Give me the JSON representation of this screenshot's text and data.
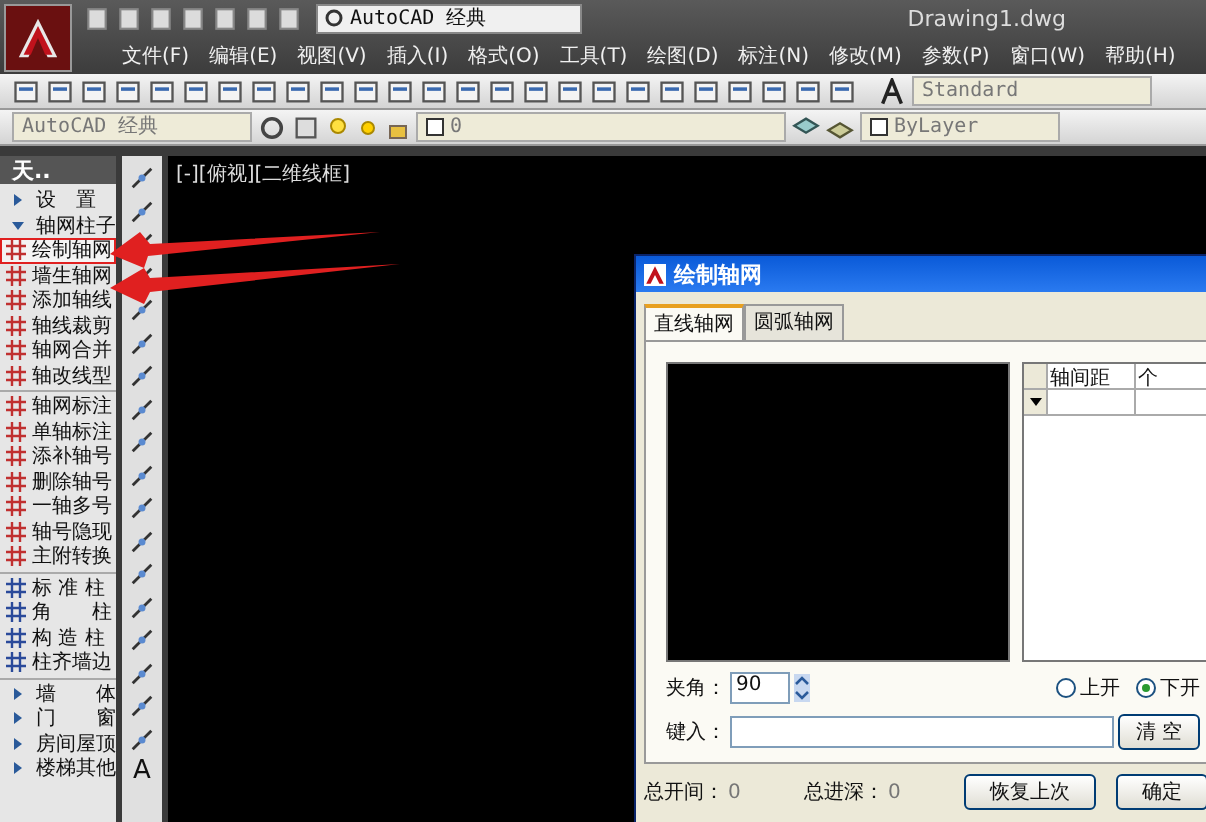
{
  "title_bar": {
    "workspace": "AutoCAD 经典",
    "file_name": "Drawing1.dwg"
  },
  "menu": [
    "文件(F)",
    "编辑(E)",
    "视图(V)",
    "插入(I)",
    "格式(O)",
    "工具(T)",
    "绘图(D)",
    "标注(N)",
    "修改(M)",
    "参数(P)",
    "窗口(W)",
    "帮助(H)"
  ],
  "toolbar": {
    "text_style": "Standard",
    "workspace": "AutoCAD 经典",
    "layer": "0",
    "color_control": "ByLayer"
  },
  "palette": {
    "title": "天..",
    "sections": [
      {
        "label": "设　置",
        "expanded": false
      },
      {
        "label": "轴网柱子",
        "expanded": true,
        "groups": [
          [
            {
              "label": "绘制轴网",
              "selected": true
            },
            {
              "label": "墙生轴网",
              "selected": false
            },
            {
              "label": "添加轴线",
              "selected": false
            },
            {
              "label": "轴线裁剪",
              "selected": false
            },
            {
              "label": "轴网合并",
              "selected": false
            },
            {
              "label": "轴改线型",
              "selected": false
            }
          ],
          [
            {
              "label": "轴网标注",
              "selected": false
            },
            {
              "label": "单轴标注",
              "selected": false
            },
            {
              "label": "添补轴号",
              "selected": false
            },
            {
              "label": "删除轴号",
              "selected": false
            },
            {
              "label": "一轴多号",
              "selected": false
            },
            {
              "label": "轴号隐现",
              "selected": false
            },
            {
              "label": "主附转换",
              "selected": false
            }
          ],
          [
            {
              "label": "标 准 柱",
              "selected": false
            },
            {
              "label": "角　　柱",
              "selected": false
            },
            {
              "label": "构 造 柱",
              "selected": false
            },
            {
              "label": "柱齐墙边",
              "selected": false
            }
          ]
        ]
      },
      {
        "label": "墙　　体",
        "expanded": false
      },
      {
        "label": "门　　窗",
        "expanded": false
      },
      {
        "label": "房间屋顶",
        "expanded": false
      },
      {
        "label": "楼梯其他",
        "expanded": false
      }
    ]
  },
  "text_tool": "A",
  "viewport": {
    "label": "[-][俯视][二维线框]"
  },
  "dialog": {
    "title": "绘制轴网",
    "tabs": [
      {
        "label": "直线轴网",
        "selected": true
      },
      {
        "label": "圆弧轴网",
        "selected": false
      }
    ],
    "table": {
      "columns": [
        "轴间距",
        "个"
      ]
    },
    "angle": {
      "label": "夹角：",
      "value": "90"
    },
    "radios": [
      {
        "label": "上开",
        "selected": false
      },
      {
        "label": "下开",
        "selected": true
      }
    ],
    "input": {
      "label": "键入："
    },
    "clear_button": "清 空",
    "total_width": {
      "label": "总开间：",
      "value": "0"
    },
    "total_depth": {
      "label": "总进深：",
      "value": "0"
    },
    "buttons": [
      "恢复上次",
      "确定"
    ]
  }
}
